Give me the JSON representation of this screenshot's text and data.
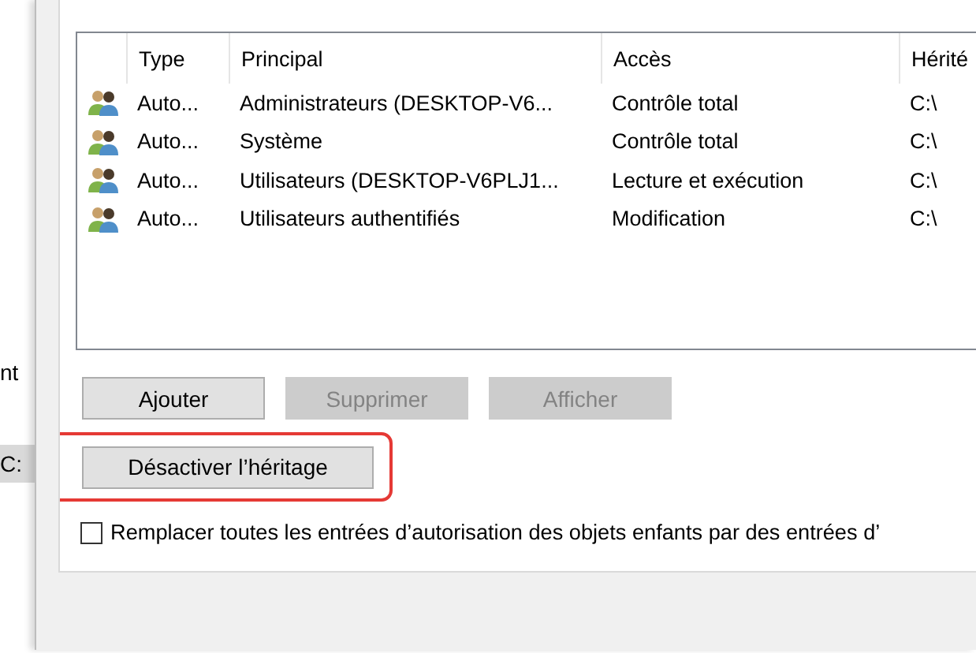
{
  "permissions_list": {
    "columns": [
      "Type",
      "Principal",
      "Accès",
      "Hérité"
    ],
    "rows": [
      {
        "type": "Auto...",
        "principal": "Administrateurs (DESKTOP-V6...",
        "access": "Contrôle total",
        "inherited": "C:\\"
      },
      {
        "type": "Auto...",
        "principal": "Système",
        "access": "Contrôle total",
        "inherited": "C:\\"
      },
      {
        "type": "Auto...",
        "principal": "Utilisateurs (DESKTOP-V6PLJ1...",
        "access": "Lecture et exécution",
        "inherited": "C:\\"
      },
      {
        "type": "Auto...",
        "principal": "Utilisateurs authentifiés",
        "access": "Modification",
        "inherited": "C:\\"
      }
    ]
  },
  "buttons": [
    {
      "label": "Ajouter",
      "disabled": false
    },
    {
      "label": "Supprimer",
      "disabled": true
    },
    {
      "label": "Afficher",
      "disabled": true
    }
  ],
  "inheritance_button": {
    "label": "Désactiver l’héritage",
    "highlighted": true
  },
  "replace_checkbox": {
    "label": "Remplacer toutes les entrées d’autorisation des objets enfants par des entrées d’",
    "checked": false
  },
  "background_window": {
    "labels": [
      "nt",
      "C:"
    ]
  }
}
